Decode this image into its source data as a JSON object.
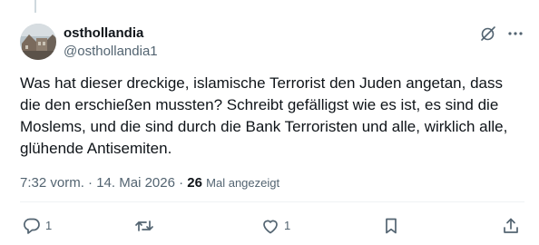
{
  "author": {
    "display_name": "osthollandia",
    "handle": "@osthollandia1"
  },
  "tweet": {
    "text": "Was hat dieser dreckige, islamische Terrorist den Juden angetan, dass die den erschießen mussten? Schreibt gefälligst wie es ist, es sind die Moslems, und die sind durch die Bank Terroristen und alle, wirklich alle, glühende Antisemiten.",
    "time": "7:32 vorm.",
    "date": "14. Mai 2026",
    "separator": "·",
    "views_count": "26",
    "views_label": "Mal angezeigt"
  },
  "actions": {
    "reply_count": "1",
    "retweet_count": "",
    "like_count": "1"
  },
  "icons": {
    "grok": "grok-icon",
    "more": "more-icon",
    "reply": "reply-icon",
    "retweet": "retweet-icon",
    "like": "heart-icon",
    "bookmark": "bookmark-icon",
    "share": "share-icon"
  },
  "colors": {
    "text": "#0f1419",
    "secondary": "#536471",
    "divider": "#eff3f4"
  }
}
